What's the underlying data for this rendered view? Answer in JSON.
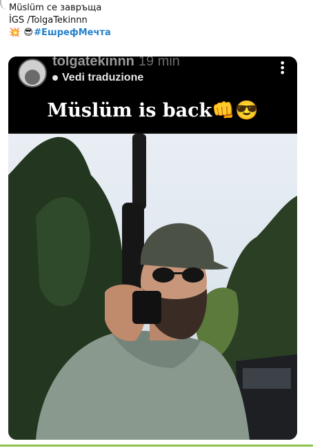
{
  "post": {
    "line1": "Müslüm се завръща",
    "line2": "İGS /TolgaTekinnn",
    "emoji1": "💥",
    "emoji2": "😎",
    "hashtag": "#ЕшрефМечта"
  },
  "story": {
    "username": "tolgatekinnn",
    "time": "19 min",
    "translate_label": "Vedi traduzione",
    "caption": "Müslüm is back👊😎"
  },
  "colors": {
    "hashtag": "#2481cc",
    "divider": "#8bc34a"
  }
}
